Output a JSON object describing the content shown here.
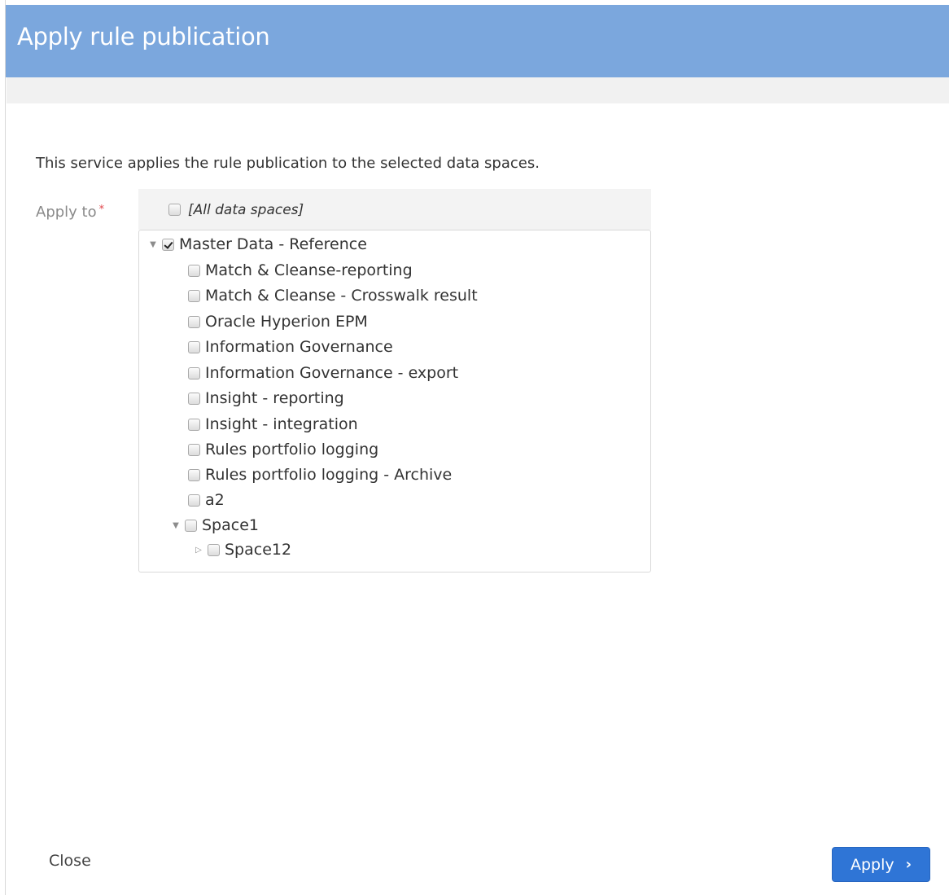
{
  "dialog": {
    "title": "Apply rule publication",
    "description": "This service applies the rule publication to the selected data spaces."
  },
  "form": {
    "apply_to_label": "Apply to",
    "required_marker": "*",
    "all_spaces_label": "[All data spaces]",
    "all_spaces_checked": false
  },
  "tree": {
    "items": [
      {
        "label": "Master Data - Reference",
        "checked": true,
        "toggle": "expanded"
      },
      {
        "label": "Match & Cleanse-reporting",
        "checked": false
      },
      {
        "label": "Match & Cleanse - Crosswalk result",
        "checked": false
      },
      {
        "label": "Oracle Hyperion EPM",
        "checked": false
      },
      {
        "label": "Information Governance",
        "checked": false
      },
      {
        "label": "Information Governance - export",
        "checked": false
      },
      {
        "label": "Insight - reporting",
        "checked": false
      },
      {
        "label": "Insight - integration",
        "checked": false
      },
      {
        "label": "Rules portfolio logging",
        "checked": false
      },
      {
        "label": "Rules portfolio logging - Archive",
        "checked": false
      },
      {
        "label": "a2",
        "checked": false
      },
      {
        "label": "Space1",
        "checked": false,
        "toggle": "expanded"
      },
      {
        "label": "Space12",
        "checked": false,
        "toggle": "collapsed"
      }
    ]
  },
  "footer": {
    "close_label": "Close",
    "apply_label": "Apply",
    "apply_icon": "chevron-right-icon"
  },
  "colors": {
    "header_bg": "#7ba7dd",
    "apply_bg": "#2f75d6",
    "required": "#e0464b"
  }
}
